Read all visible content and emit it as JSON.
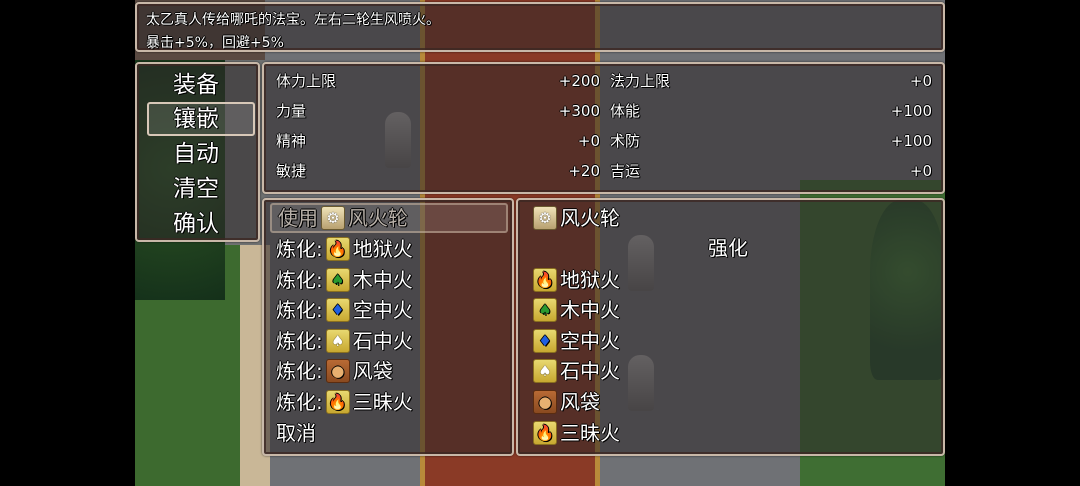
{
  "help": {
    "line1": "太乙真人传给哪吒的法宝。左右二轮生风喷火。",
    "line2": "暴击+5%，回避+5%"
  },
  "commands": [
    "装备",
    "镶嵌",
    "自动",
    "清空",
    "确认"
  ],
  "selected_command_index": 1,
  "stats": {
    "left": [
      {
        "label": "体力上限",
        "value": "+200"
      },
      {
        "label": "力量",
        "value": "+300"
      },
      {
        "label": "精神",
        "value": "+0"
      },
      {
        "label": "敏捷",
        "value": "+20"
      }
    ],
    "right": [
      {
        "label": "法力上限",
        "value": "+0"
      },
      {
        "label": "体能",
        "value": "+100"
      },
      {
        "label": "术防",
        "value": "+100"
      },
      {
        "label": "吉运",
        "value": "+0"
      }
    ]
  },
  "slots": {
    "use": {
      "prefix": "使用",
      "item": "风火轮",
      "icon": "wheel-icon"
    },
    "refine_prefix": "炼化:",
    "items": [
      {
        "name": "地狱火",
        "icon": "red-flame-icon"
      },
      {
        "name": "木中火",
        "icon": "green-flame-icon"
      },
      {
        "name": "空中火",
        "icon": "blue-flame-icon"
      },
      {
        "name": "石中火",
        "icon": "white-flame-icon"
      },
      {
        "name": "风袋",
        "icon": "wind-bag-icon"
      },
      {
        "name": "三昧火",
        "icon": "red-flame-icon"
      }
    ],
    "cancel": "取消"
  },
  "detail": {
    "title": "风火轮",
    "enhance_label": "强化",
    "items": [
      "地狱火",
      "木中火",
      "空中火",
      "石中火",
      "风袋",
      "三昧火"
    ]
  }
}
